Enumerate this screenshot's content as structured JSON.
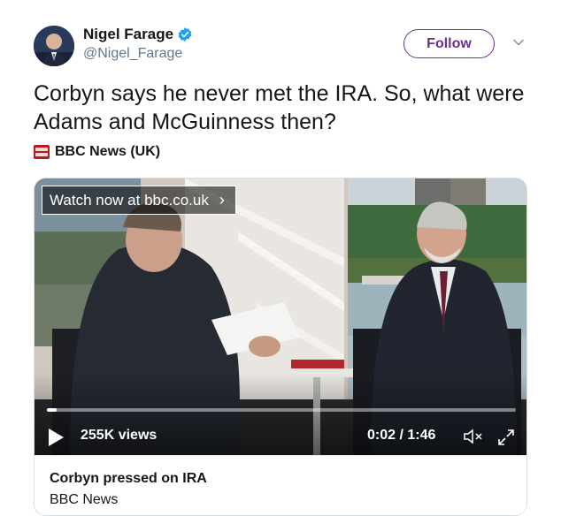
{
  "tweet": {
    "author": {
      "display_name": "Nigel Farage",
      "handle": "@Nigel_Farage",
      "verified": true,
      "avatar_icon": "user-avatar-photo"
    },
    "follow_label": "Follow",
    "text": "Corbyn says he never met the IRA. So, what were Adams and McGuinness then?",
    "source": {
      "logo_icon": "bbc-news-logo",
      "name": "BBC News (UK)"
    }
  },
  "video_card": {
    "watch_badge": "Watch now at bbc.co.uk",
    "views": "255K views",
    "time": "0:02 / 1:46",
    "progress": 0.02,
    "title": "Corbyn pressed on IRA",
    "source": "BBC News"
  },
  "colors": {
    "follow_accent": "#6b2f8e",
    "verified": "#1da1f2",
    "bbc_red": "#bb1919",
    "text_primary": "#14171a",
    "text_secondary": "#657786"
  }
}
